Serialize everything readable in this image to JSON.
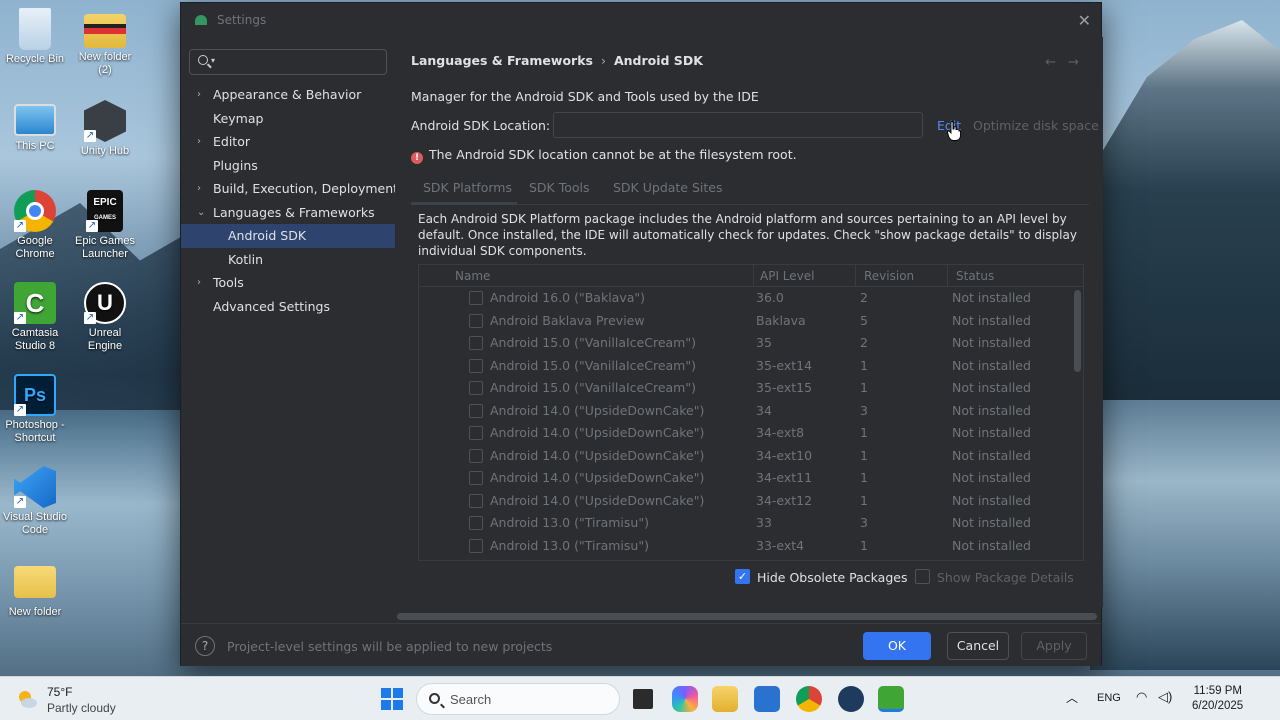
{
  "desktop": {
    "icons": [
      {
        "label": "Recycle Bin",
        "color": "#cfe3f3"
      },
      {
        "label": "New folder (2)",
        "color": "#f2c94c"
      },
      {
        "label": "This PC",
        "color": "#4aa3df"
      },
      {
        "label": "Unity Hub",
        "color": "#2f3338"
      },
      {
        "label": "Google Chrome",
        "color": "#db4437"
      },
      {
        "label": "Epic Games Launcher",
        "color": "#111111"
      },
      {
        "label": "Camtasia Studio 8",
        "color": "#3fa535"
      },
      {
        "label": "Unreal Engine",
        "color": "#111111"
      },
      {
        "label": "Photoshop - Shortcut",
        "color": "#001e36"
      },
      {
        "label": "Visual Studio Code",
        "color": "#1e88e5"
      },
      {
        "label": "New folder",
        "color": "#f2c94c"
      }
    ]
  },
  "dialog": {
    "title": "Settings",
    "sidebar": {
      "search_placeholder": "",
      "items": [
        {
          "label": "Appearance & Behavior",
          "expandable": true,
          "expanded": false
        },
        {
          "label": "Keymap",
          "expandable": false
        },
        {
          "label": "Editor",
          "expandable": true,
          "expanded": false
        },
        {
          "label": "Plugins",
          "expandable": false
        },
        {
          "label": "Build, Execution, Deployment",
          "expandable": true,
          "expanded": false
        },
        {
          "label": "Languages & Frameworks",
          "expandable": true,
          "expanded": true
        },
        {
          "label": "Android SDK",
          "child": true,
          "selected": true
        },
        {
          "label": "Kotlin",
          "child": true
        },
        {
          "label": "Tools",
          "expandable": true,
          "expanded": false
        },
        {
          "label": "Advanced Settings",
          "expandable": false
        }
      ]
    },
    "breadcrumb": {
      "parent": "Languages & Frameworks",
      "separator": "›",
      "current": "Android SDK"
    },
    "description": "Manager for the Android SDK and Tools used by the IDE",
    "sdk_location": {
      "label": "Android SDK Location:",
      "value": "",
      "edit": "Edit",
      "optimize": "Optimize disk space"
    },
    "error": "The Android SDK location cannot be at the filesystem root.",
    "tabs": [
      "SDK Platforms",
      "SDK Tools",
      "SDK Update Sites"
    ],
    "info_text": "Each Android SDK Platform package includes the Android platform and sources pertaining to an API level by default. Once installed, the IDE will automatically check for updates. Check \"show package details\" to display individual SDK components.",
    "table": {
      "columns": [
        "Name",
        "API Level",
        "Revision",
        "Status"
      ],
      "rows": [
        {
          "name": "Android 16.0 (\"Baklava\")",
          "api": "36.0",
          "rev": "2",
          "status": "Not installed"
        },
        {
          "name": "Android Baklava Preview",
          "api": "Baklava",
          "rev": "5",
          "status": "Not installed"
        },
        {
          "name": "Android 15.0 (\"VanillaIceCream\")",
          "api": "35",
          "rev": "2",
          "status": "Not installed"
        },
        {
          "name": "Android 15.0 (\"VanillaIceCream\")",
          "api": "35-ext14",
          "rev": "1",
          "status": "Not installed"
        },
        {
          "name": "Android 15.0 (\"VanillaIceCream\")",
          "api": "35-ext15",
          "rev": "1",
          "status": "Not installed"
        },
        {
          "name": "Android 14.0 (\"UpsideDownCake\")",
          "api": "34",
          "rev": "3",
          "status": "Not installed"
        },
        {
          "name": "Android 14.0 (\"UpsideDownCake\")",
          "api": "34-ext8",
          "rev": "1",
          "status": "Not installed"
        },
        {
          "name": "Android 14.0 (\"UpsideDownCake\")",
          "api": "34-ext10",
          "rev": "1",
          "status": "Not installed"
        },
        {
          "name": "Android 14.0 (\"UpsideDownCake\")",
          "api": "34-ext11",
          "rev": "1",
          "status": "Not installed"
        },
        {
          "name": "Android 14.0 (\"UpsideDownCake\")",
          "api": "34-ext12",
          "rev": "1",
          "status": "Not installed"
        },
        {
          "name": "Android 13.0 (\"Tiramisu\")",
          "api": "33",
          "rev": "3",
          "status": "Not installed"
        },
        {
          "name": "Android 13.0 (\"Tiramisu\")",
          "api": "33-ext4",
          "rev": "1",
          "status": "Not installed"
        }
      ]
    },
    "options": {
      "hide_obsolete": "Hide Obsolete Packages",
      "hide_obsolete_checked": true,
      "show_details": "Show Package Details",
      "show_details_checked": false
    },
    "footer": {
      "note": "Project-level settings will be applied to new projects",
      "ok": "OK",
      "cancel": "Cancel",
      "apply": "Apply"
    }
  },
  "taskbar": {
    "weather_temp": "75°F",
    "weather_cond": "Partly cloudy",
    "search_placeholder": "Search",
    "language": "ENG",
    "time": "11:59 PM",
    "date": "6/20/2025"
  }
}
